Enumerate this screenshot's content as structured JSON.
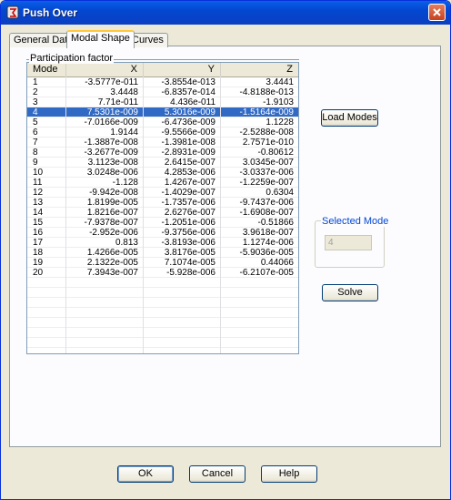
{
  "window": {
    "title": "Push Over"
  },
  "tabs": [
    {
      "label": "General Data"
    },
    {
      "label": "Modal Shape"
    },
    {
      "label": "Curves"
    }
  ],
  "table": {
    "group_label": "Participation factor",
    "columns": [
      "Mode",
      "X",
      "Y",
      "Z"
    ],
    "selected_row": 3,
    "rows": [
      [
        "1",
        "-3.5777e-011",
        "-3.8554e-013",
        "3.4441"
      ],
      [
        "2",
        "3.4448",
        "-6.8357e-014",
        "-4.8188e-013"
      ],
      [
        "3",
        "7.71e-011",
        "4.436e-011",
        "-1.9103"
      ],
      [
        "4",
        "7.5301e-009",
        "5.3016e-009",
        "-1.5164e-009"
      ],
      [
        "5",
        "-7.0166e-009",
        "-6.4736e-009",
        "1.1228"
      ],
      [
        "6",
        "1.9144",
        "-9.5566e-009",
        "-2.5288e-008"
      ],
      [
        "7",
        "-1.3887e-008",
        "-1.3981e-008",
        "2.7571e-010"
      ],
      [
        "8",
        "-3.2677e-009",
        "-2.8931e-009",
        "-0.80612"
      ],
      [
        "9",
        "3.1123e-008",
        "2.6415e-007",
        "3.0345e-007"
      ],
      [
        "10",
        "3.0248e-006",
        "4.2853e-006",
        "-3.0337e-006"
      ],
      [
        "11",
        "-1.128",
        "1.4267e-007",
        "-1.2259e-007"
      ],
      [
        "12",
        "-9.942e-008",
        "-1.4029e-007",
        "0.6304"
      ],
      [
        "13",
        "1.8199e-005",
        "-1.7357e-006",
        "-9.7437e-006"
      ],
      [
        "14",
        "1.8216e-007",
        "2.6276e-007",
        "-1.6908e-007"
      ],
      [
        "15",
        "-7.9378e-007",
        "-1.2051e-006",
        "-0.51866"
      ],
      [
        "16",
        "-2.952e-006",
        "-9.3756e-006",
        "3.9618e-007"
      ],
      [
        "17",
        "0.813",
        "-3.8193e-006",
        "1.1274e-006"
      ],
      [
        "18",
        "1.4266e-005",
        "3.8176e-005",
        "-5.9036e-005"
      ],
      [
        "19",
        "2.1322e-005",
        "7.1074e-005",
        "0.44066"
      ],
      [
        "20",
        "7.3943e-007",
        "-5.928e-006",
        "-6.2107e-005"
      ]
    ]
  },
  "load_modes": {
    "label": "Load Modes"
  },
  "selected_mode": {
    "label": "Selected Mode",
    "value": "4"
  },
  "solve": {
    "label": "Solve"
  },
  "footer": {
    "ok": "OK",
    "cancel": "Cancel",
    "help": "Help"
  },
  "icons": {
    "app": "app-icon",
    "close": "close-icon"
  }
}
